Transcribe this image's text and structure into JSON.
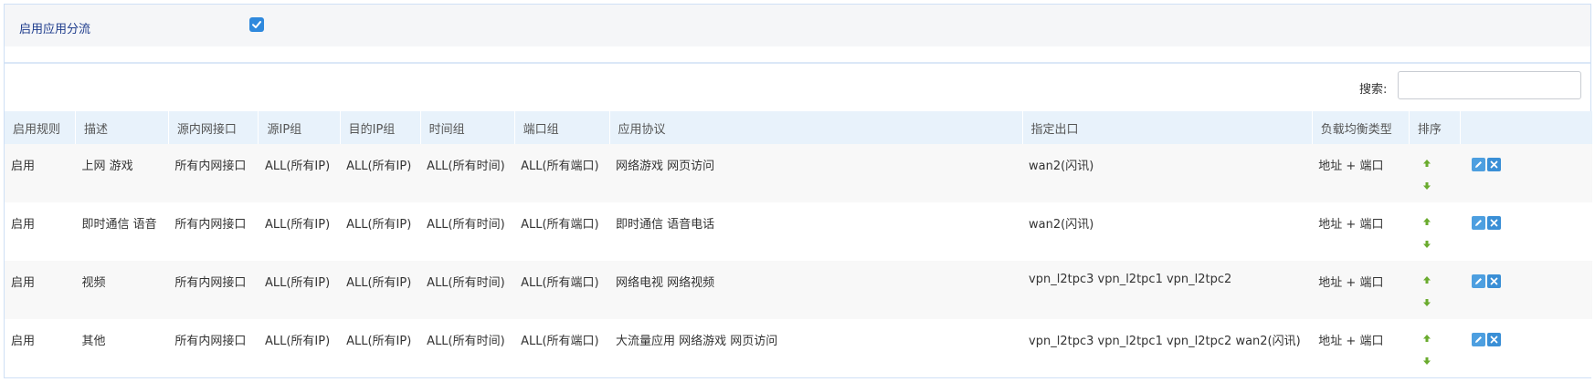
{
  "settings": {
    "enable_label": "启用应用分流",
    "enable_checked": true
  },
  "search": {
    "label": "搜索:",
    "value": "",
    "placeholder": ""
  },
  "table": {
    "headers": [
      "启用规则",
      "描述",
      "源内网接口",
      "源IP组",
      "目的IP组",
      "时间组",
      "端口组",
      "应用协议",
      "指定出口",
      "负载均衡类型",
      "排序",
      ""
    ],
    "rows": [
      {
        "status": "启用",
        "desc": "上网 游戏",
        "src_iface": "所有内网接口",
        "src_ip": "ALL(所有IP)",
        "dst_ip": "ALL(所有IP)",
        "time": "ALL(所有时间)",
        "port": "ALL(所有端口)",
        "proto": "网络游戏 网页访问",
        "exit": "wan2(闪讯)",
        "lb": "地址 + 端口"
      },
      {
        "status": "启用",
        "desc": "即时通信 语音",
        "src_iface": "所有内网接口",
        "src_ip": "ALL(所有IP)",
        "dst_ip": "ALL(所有IP)",
        "time": "ALL(所有时间)",
        "port": "ALL(所有端口)",
        "proto": "即时通信 语音电话",
        "exit": "wan2(闪讯)",
        "lb": "地址 + 端口"
      },
      {
        "status": "启用",
        "desc": "视频",
        "src_iface": "所有内网接口",
        "src_ip": "ALL(所有IP)",
        "dst_ip": "ALL(所有IP)",
        "time": "ALL(所有时间)",
        "port": "ALL(所有端口)",
        "proto": "网络电视 网络视频",
        "exit": "vpn_l2tpc3 vpn_l2tpc1 vpn_l2tpc2",
        "lb": "地址 + 端口"
      },
      {
        "status": "启用",
        "desc": "其他",
        "src_iface": "所有内网接口",
        "src_ip": "ALL(所有IP)",
        "dst_ip": "ALL(所有IP)",
        "time": "ALL(所有时间)",
        "port": "ALL(所有端口)",
        "proto": "大流量应用 网络游戏 网页访问",
        "exit": "vpn_l2tpc3 vpn_l2tpc1 vpn_l2tpc2 wan2(闪讯)",
        "lb": "地址 + 端口"
      }
    ]
  },
  "icons": {
    "sort_up": "arrow-up-icon",
    "sort_down": "arrow-down-icon",
    "edit": "pencil-icon",
    "delete": "close-icon"
  },
  "colors": {
    "accent": "#2f89dd",
    "header_bg": "#e8f2fb",
    "arrow": "#6aab2e",
    "label": "#1e3c8c"
  }
}
